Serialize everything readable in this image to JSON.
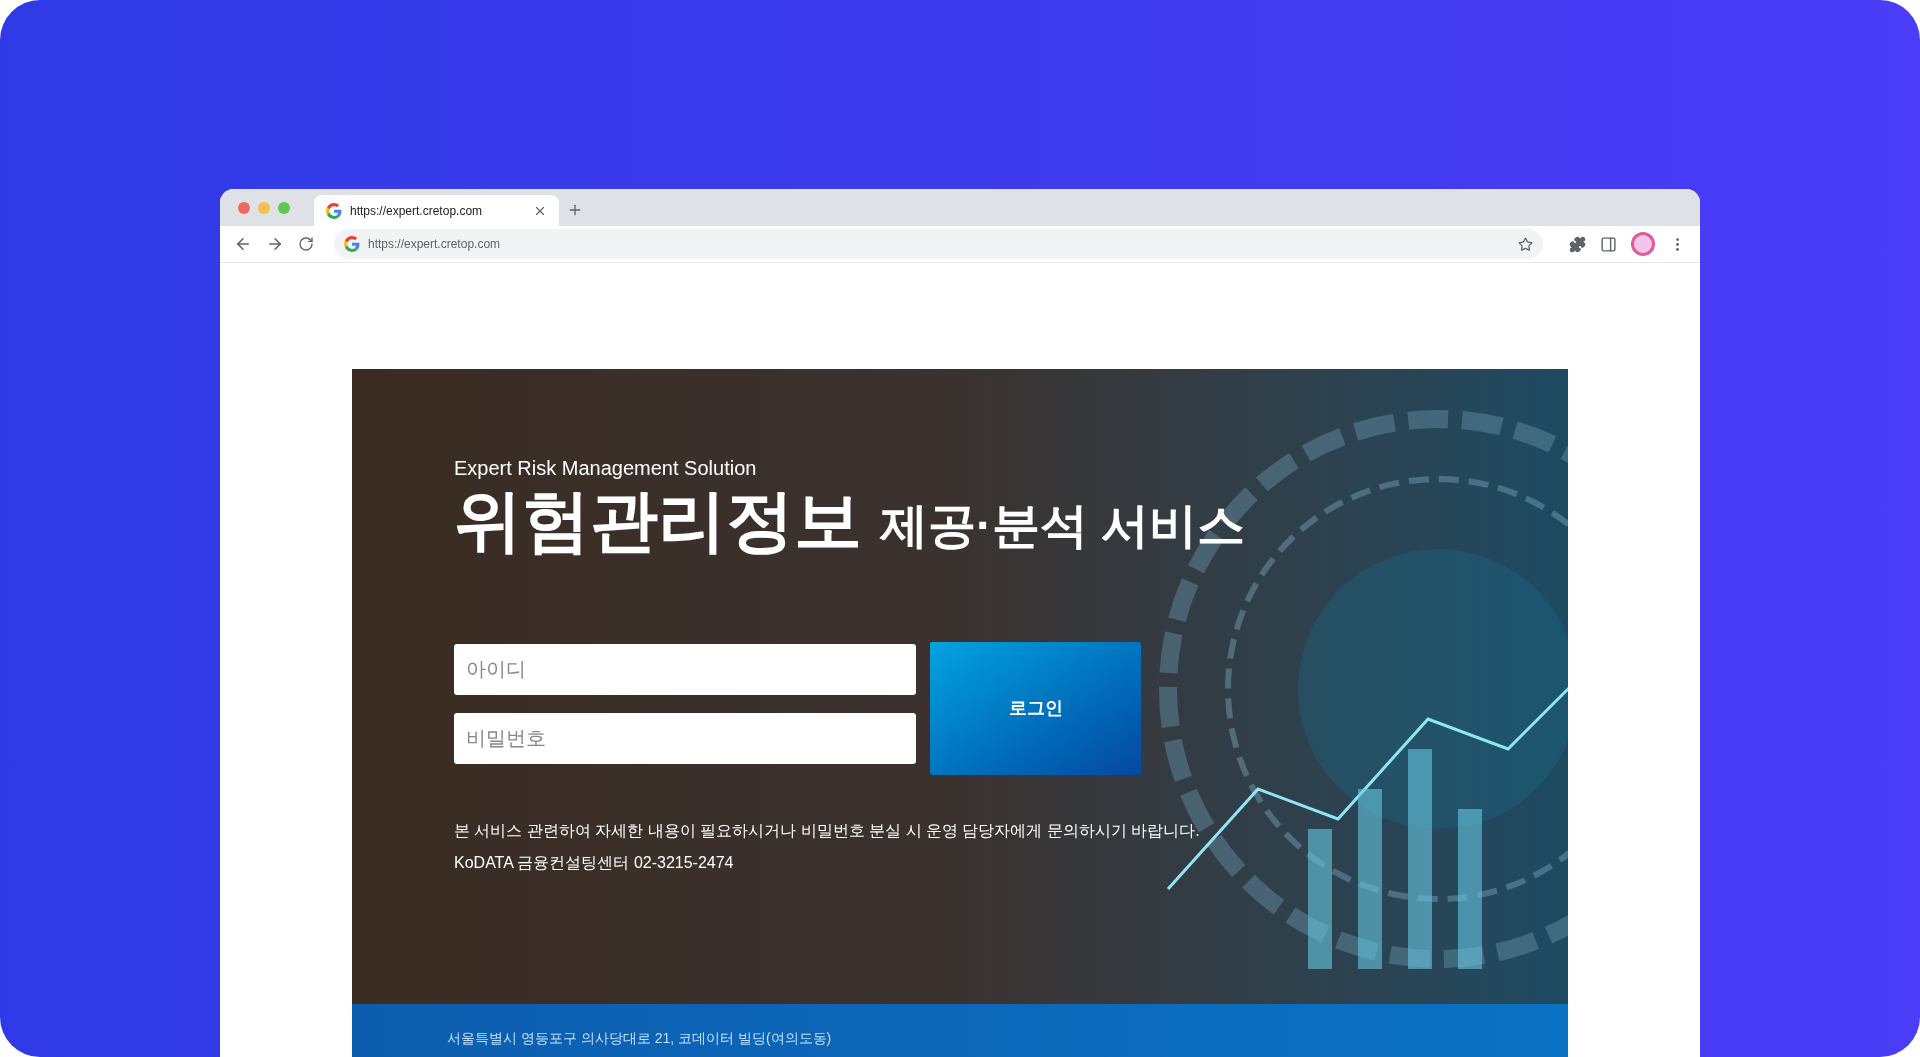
{
  "browser": {
    "tab": {
      "title": "https://expert.cretop.com",
      "selected": true
    },
    "address": "https://expert.cretop.com"
  },
  "hero": {
    "subtitle": "Expert Risk Management Solution",
    "title_main": "위험관리정보",
    "title_sub": "제공·분석 서비스"
  },
  "login": {
    "id_field": {
      "placeholder": "아이디"
    },
    "password_field": {
      "placeholder": "비밀번호"
    },
    "button": "로그인"
  },
  "notice": [
    "본 서비스 관련하여 자세한 내용이 필요하시거나 비밀번호 분실 시 운영 담당자에게 문의하시기 바랍니다.",
    "KoDATA 금융컨설팅센터 02-3215-2474"
  ],
  "footer": {
    "address": "서울특별시 영등포구 의사당대로 21, 코데이터 빌딩(여의도동)"
  }
}
